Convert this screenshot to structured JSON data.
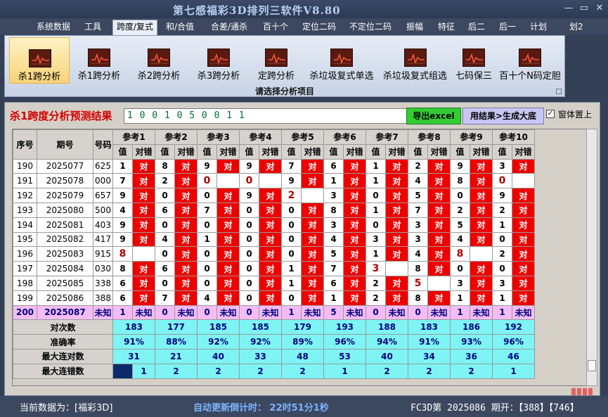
{
  "window": {
    "title": "第七感福彩3D排列三软件V8.80",
    "min_icon": "minimize-icon",
    "max_icon": "maximize-icon",
    "close_icon": "close-icon",
    "min_glyph": "—",
    "max_glyph": "▭",
    "close_glyph": "✕"
  },
  "menu": [
    "系统数据",
    "工具",
    "跨度/复式",
    "和/合值",
    "合差/通杀",
    "百十个",
    "定位二码",
    "不定位二码",
    "振幅",
    "特征",
    "后二",
    "后一",
    "计划",
    "划2"
  ],
  "menu_active": "跨度/复式",
  "ribbon": {
    "buttons": [
      "杀1跨分析",
      "杀1跨分析",
      "杀2跨分析",
      "杀3跨分析",
      "定跨分析",
      "杀垃圾复式单选",
      "杀垃圾复式组选",
      "七码保三",
      "百十个N码定胆"
    ],
    "selected_index": 0,
    "group_label": "请选择分析项目",
    "icon": "chart-icon"
  },
  "panel": {
    "title": "杀1跨度分析预测结果",
    "result": "1 0 0 1 0 5 0 0 1 1",
    "export_label": "导出excel",
    "gen_label": "用结果>生成大底",
    "topmost_label": "窗体置上",
    "topmost_checked": true,
    "check_glyph": "✓"
  },
  "table": {
    "h_seq": "序号",
    "h_period": "期号",
    "h_code": "号码",
    "refs": [
      "参考1",
      "参考2",
      "参考3",
      "参考4",
      "参考5",
      "参考6",
      "参考7",
      "参考8",
      "参考9",
      "参考10"
    ],
    "sub_val": "值",
    "sub_ok": "对错",
    "ok_text": "对",
    "rows": [
      {
        "seq": "190",
        "period": "2025077",
        "code": "625",
        "vals": [
          "1",
          "8",
          "9",
          "9",
          "7",
          "6",
          "1",
          "2",
          "9",
          "3"
        ],
        "ok": [
          true,
          true,
          true,
          true,
          true,
          true,
          true,
          true,
          true,
          true
        ]
      },
      {
        "seq": "191",
        "period": "2025078",
        "code": "000",
        "vals": [
          "7",
          "2",
          "0",
          "0",
          "9",
          "1",
          "1",
          "4",
          "8",
          "0"
        ],
        "ok": [
          true,
          true,
          false,
          false,
          true,
          true,
          true,
          true,
          true,
          false
        ]
      },
      {
        "seq": "192",
        "period": "2025079",
        "code": "657",
        "vals": [
          "9",
          "0",
          "0",
          "9",
          "2",
          "3",
          "0",
          "5",
          "0",
          "9"
        ],
        "ok": [
          true,
          true,
          true,
          true,
          false,
          true,
          true,
          true,
          true,
          true
        ]
      },
      {
        "seq": "193",
        "period": "2025080",
        "code": "500",
        "vals": [
          "4",
          "6",
          "7",
          "0",
          "0",
          "8",
          "1",
          "7",
          "2",
          "2"
        ],
        "ok": [
          true,
          true,
          true,
          true,
          true,
          true,
          true,
          true,
          true,
          true
        ]
      },
      {
        "seq": "194",
        "period": "2025081",
        "code": "403",
        "vals": [
          "9",
          "0",
          "0",
          "0",
          "0",
          "3",
          "0",
          "3",
          "5",
          "1"
        ],
        "ok": [
          true,
          true,
          true,
          true,
          true,
          true,
          true,
          true,
          true,
          true
        ]
      },
      {
        "seq": "195",
        "period": "2025082",
        "code": "417",
        "vals": [
          "9",
          "4",
          "1",
          "0",
          "0",
          "4",
          "3",
          "3",
          "4",
          "0"
        ],
        "ok": [
          true,
          true,
          true,
          true,
          true,
          true,
          true,
          true,
          true,
          true
        ]
      },
      {
        "seq": "196",
        "period": "2025083",
        "code": "915",
        "vals": [
          "8",
          "0",
          "0",
          "0",
          "0",
          "5",
          "1",
          "4",
          "8",
          "2"
        ],
        "ok": [
          false,
          true,
          true,
          true,
          true,
          true,
          true,
          true,
          false,
          true
        ]
      },
      {
        "seq": "197",
        "period": "2025084",
        "code": "030",
        "vals": [
          "8",
          "6",
          "0",
          "0",
          "1",
          "7",
          "3",
          "8",
          "0",
          "0"
        ],
        "ok": [
          true,
          true,
          true,
          true,
          true,
          true,
          false,
          true,
          true,
          true
        ]
      },
      {
        "seq": "198",
        "period": "2025085",
        "code": "338",
        "vals": [
          "6",
          "0",
          "0",
          "0",
          "1",
          "6",
          "2",
          "5",
          "3",
          "3"
        ],
        "ok": [
          true,
          true,
          true,
          true,
          true,
          true,
          true,
          false,
          true,
          true
        ]
      },
      {
        "seq": "199",
        "period": "2025086",
        "code": "388",
        "vals": [
          "6",
          "7",
          "4",
          "0",
          "0",
          "1",
          "2",
          "8",
          "1",
          "1"
        ],
        "ok": [
          true,
          true,
          true,
          true,
          true,
          true,
          true,
          true,
          true,
          true
        ]
      }
    ],
    "highlight_cells": [
      [
        1,
        2
      ],
      [
        1,
        3
      ],
      [
        1,
        9
      ],
      [
        2,
        4
      ],
      [
        6,
        0
      ],
      [
        6,
        8
      ],
      [
        7,
        6
      ],
      [
        8,
        7
      ]
    ],
    "unknown_row": {
      "seq": "200",
      "period": "2025087",
      "code": "未知",
      "vals": [
        "1",
        "0",
        "0",
        "0",
        "1",
        "5",
        "0",
        "0",
        "1",
        "1"
      ],
      "status": "未知"
    },
    "stats": [
      {
        "label": "对次数",
        "vals": [
          "183",
          "177",
          "185",
          "185",
          "179",
          "193",
          "188",
          "183",
          "186",
          "192"
        ]
      },
      {
        "label": "准确率",
        "vals": [
          "91%",
          "88%",
          "92%",
          "92%",
          "89%",
          "96%",
          "94%",
          "91%",
          "93%",
          "96%"
        ]
      },
      {
        "label": "最大连对数",
        "vals": [
          "31",
          "21",
          "40",
          "33",
          "48",
          "53",
          "40",
          "34",
          "36",
          "46"
        ]
      },
      {
        "label": "最大连错数",
        "vals": [
          "1",
          "2",
          "2",
          "2",
          "2",
          "1",
          "2",
          "2",
          "2",
          "1"
        ]
      }
    ]
  },
  "status": {
    "left": "当前数据为：[福彩3D]",
    "mid": "自动更新倒计时：  22时51分1秒",
    "right": "FC3D第 2025086 期开：【388】【746】"
  }
}
